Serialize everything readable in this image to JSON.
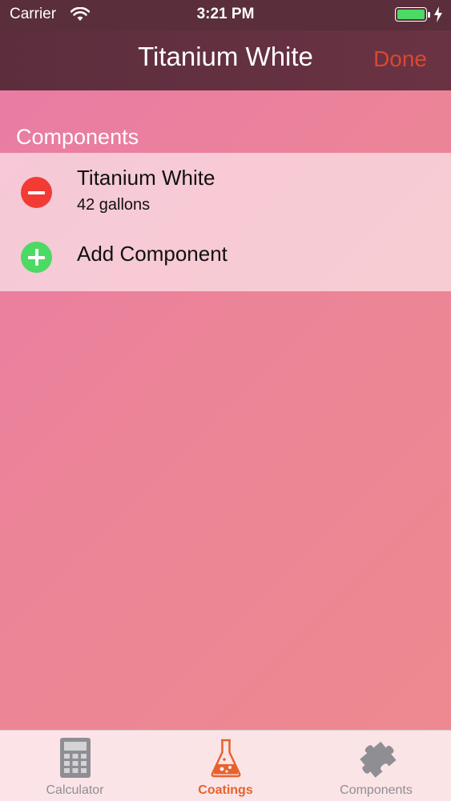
{
  "status_bar": {
    "carrier": "Carrier",
    "time": "3:21 PM"
  },
  "nav": {
    "title": "Titanium White",
    "done_label": "Done"
  },
  "section": {
    "header": "Components"
  },
  "components": [
    {
      "name": "Titanium White",
      "amount": "42 gallons"
    }
  ],
  "add_component_label": "Add Component",
  "tabs": [
    {
      "label": "Calculator",
      "icon": "calculator-icon"
    },
    {
      "label": "Coatings",
      "icon": "flask-icon",
      "selected": true
    },
    {
      "label": "Components",
      "icon": "puzzle-icon"
    }
  ],
  "colors": {
    "accent": "#e6632d",
    "done": "#d9482f",
    "delete": "#f23b35",
    "add": "#4cd964",
    "navbar": "#5c2e3d"
  }
}
